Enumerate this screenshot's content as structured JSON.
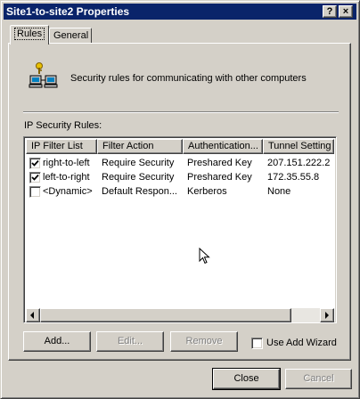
{
  "window": {
    "title": "Site1-to-site2 Properties",
    "help_button": "?",
    "close_button": "×"
  },
  "tabs": [
    {
      "label": "Rules",
      "active": true
    },
    {
      "label": "General",
      "active": false
    }
  ],
  "description": "Security rules for communicating with other computers",
  "rules_label": "IP Security Rules:",
  "columns": [
    "IP Filter List",
    "Filter Action",
    "Authentication...",
    "Tunnel Setting"
  ],
  "rows": [
    {
      "checked": true,
      "filter_list": "right-to-left",
      "filter_action": "Require Security",
      "authentication": "Preshared Key",
      "tunnel": "207.151.222.2"
    },
    {
      "checked": true,
      "filter_list": "left-to-right",
      "filter_action": "Require Security",
      "authentication": "Preshared Key",
      "tunnel": "172.35.55.8"
    },
    {
      "checked": false,
      "filter_list": "<Dynamic>",
      "filter_action": "Default Respon...",
      "authentication": "Kerberos",
      "tunnel": "None"
    }
  ],
  "buttons": {
    "add": "Add...",
    "edit": "Edit...",
    "remove": "Remove",
    "use_add_wizard": "Use Add Wizard",
    "close": "Close",
    "cancel": "Cancel"
  },
  "use_add_wizard_checked": false,
  "colors": {
    "titlebar": "#0a246a",
    "face": "#d4d0c8",
    "shadow": "#808080",
    "highlight": "#ffffff"
  },
  "icons": [
    "help-icon",
    "close-icon",
    "network-computers-icon",
    "checkbox-checked-icon",
    "scroll-left-icon",
    "scroll-right-icon",
    "mouse-pointer-icon"
  ]
}
